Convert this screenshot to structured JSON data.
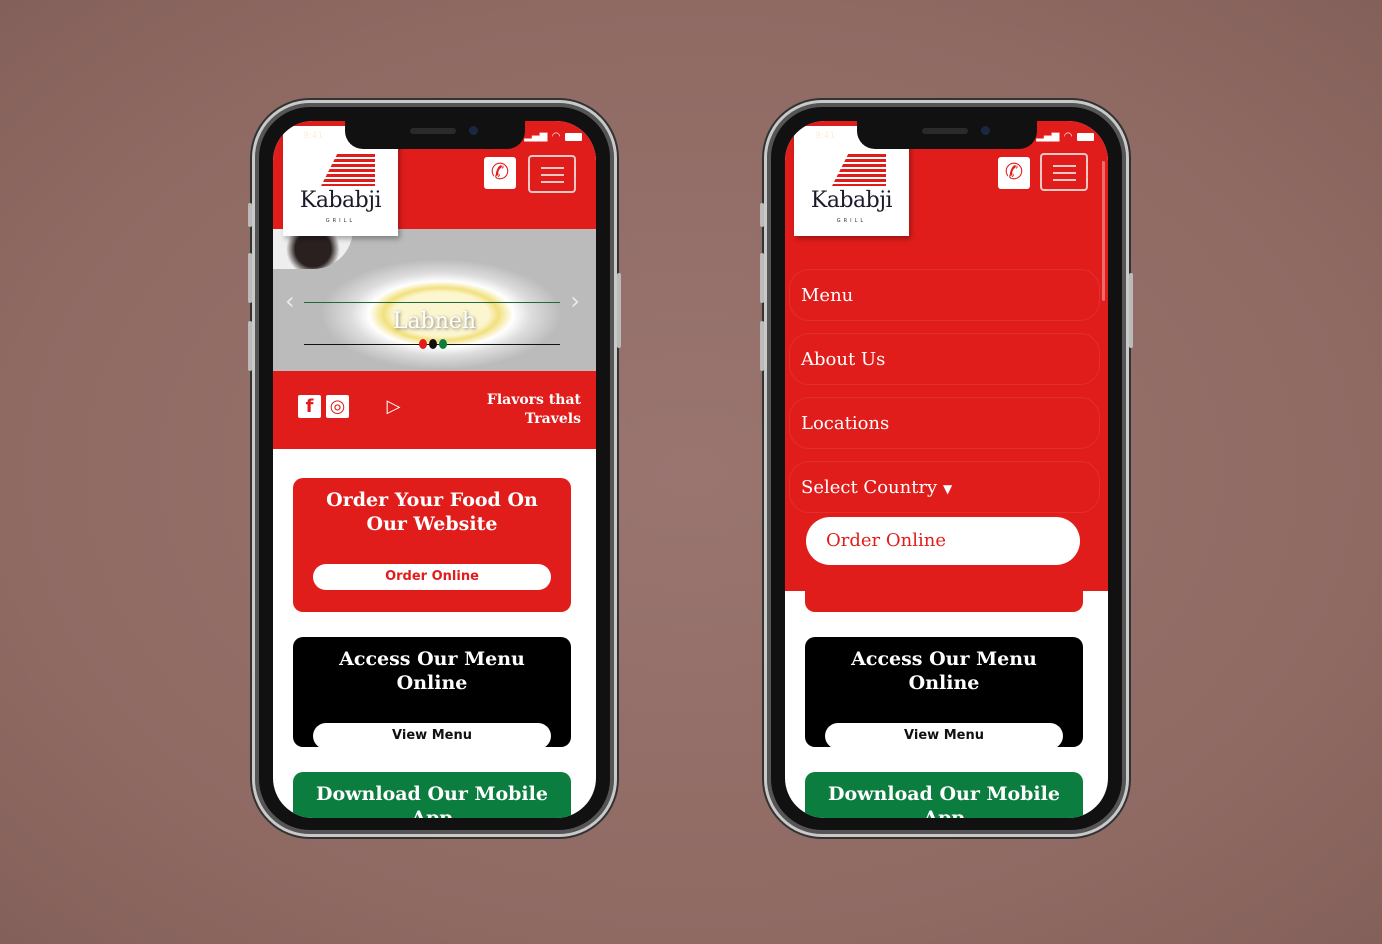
{
  "status": {
    "time": "9:41"
  },
  "brand": {
    "name": "Kababji",
    "sub": "GRILL",
    "accent": "#e11d1b",
    "green": "#0b7d3e"
  },
  "hero": {
    "slide_title": "Labneh",
    "prev": "‹",
    "next": "›"
  },
  "band": {
    "tagline_line1": "Flavors that",
    "tagline_line2": "Travels",
    "icons": [
      "facebook-icon",
      "instagram-icon",
      "apple-icon",
      "google-play-icon"
    ]
  },
  "cards": {
    "order": {
      "title": "Order Your Food On Our Website",
      "button": "Order Online"
    },
    "menu": {
      "title": "Access Our Menu Online",
      "button": "View Menu"
    },
    "app": {
      "title": "Download Our Mobile App"
    }
  },
  "nav": {
    "items": [
      "Menu",
      "About Us",
      "Locations",
      "Select Country"
    ],
    "order": "Order Online"
  }
}
